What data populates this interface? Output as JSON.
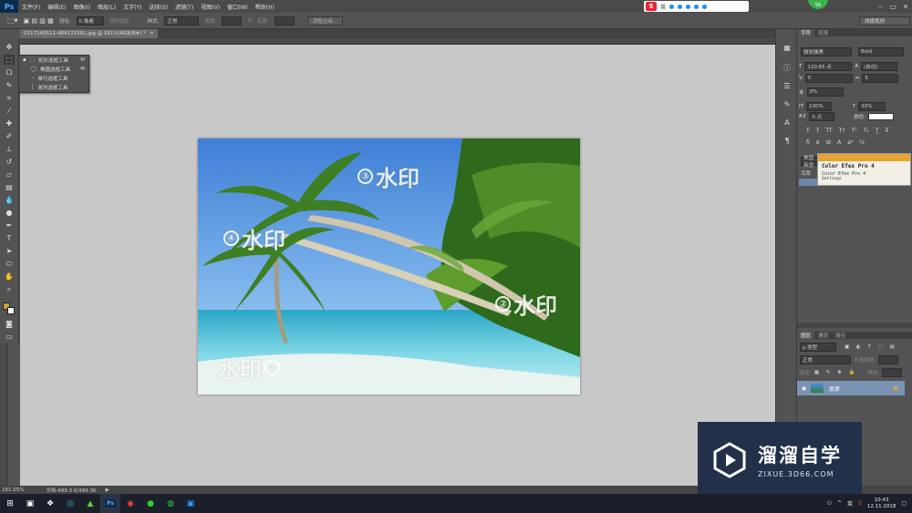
{
  "app": {
    "logo": "Ps"
  },
  "menu": [
    "文件(F)",
    "编辑(E)",
    "图像(I)",
    "图层(L)",
    "文字(Y)",
    "选择(S)",
    "滤镜(T)",
    "视图(V)",
    "窗口(W)",
    "帮助(H)"
  ],
  "ime": {
    "label": "英"
  },
  "user": {
    "badge": "56"
  },
  "options": {
    "feather_label": "羽化:",
    "feather_value": "0 像素",
    "antialias": "消除锯齿",
    "style_label": "样式:",
    "style_value": "正常",
    "width_label": "宽度:",
    "height_label": "高度:",
    "refine_button": "调整边缘...",
    "workspace": "排版规则"
  },
  "document": {
    "tab": "0117140511-484131561.jpg @ 161%(RGB/8#) *"
  },
  "flyout": {
    "items": [
      {
        "label": "矩形选框工具",
        "key": "M"
      },
      {
        "label": "椭圆选框工具",
        "key": "M"
      },
      {
        "label": "单行选框工具",
        "key": ""
      },
      {
        "label": "单列选框工具",
        "key": ""
      }
    ]
  },
  "watermarks": [
    {
      "num": "③",
      "text": "水印"
    },
    {
      "num": "④",
      "text": "水印"
    },
    {
      "num": "②",
      "text": "水印"
    },
    {
      "num": "①",
      "text": "水印"
    }
  ],
  "character_panel": {
    "tabs": [
      "字符",
      "段落"
    ],
    "font": "微软雅黑",
    "weight": "Bold",
    "size": "120.85 点",
    "leading": "(自动)",
    "kerning": "0",
    "tracking": "5",
    "tsume": "0%",
    "hscale": "100%",
    "vscale": "93%",
    "baseline": "0 点",
    "color_label": "颜色:",
    "lang": "美国英语",
    "aa": "浑厚"
  },
  "color_efex": {
    "title": "Color Efex Pro 4",
    "sub": "Color Efex Pro 4",
    "settings": "Settings"
  },
  "layers_panel": {
    "tabs": [
      "图层",
      "通道",
      "路径"
    ],
    "kind": "ρ 类型",
    "blend": "正常",
    "opacity_label": "不透明度:",
    "lock_label": "锁定:",
    "fill_label": "填充:",
    "layer_name": "背景"
  },
  "status": {
    "zoom": "161.05%",
    "doc": "文档:489.3 K/489.3K"
  },
  "tray": {
    "lang": "英",
    "time": "10:43",
    "date": "12.11.2018"
  },
  "brand": {
    "title": "溜溜自学",
    "url": "ZIXUE.3D66.COM"
  }
}
